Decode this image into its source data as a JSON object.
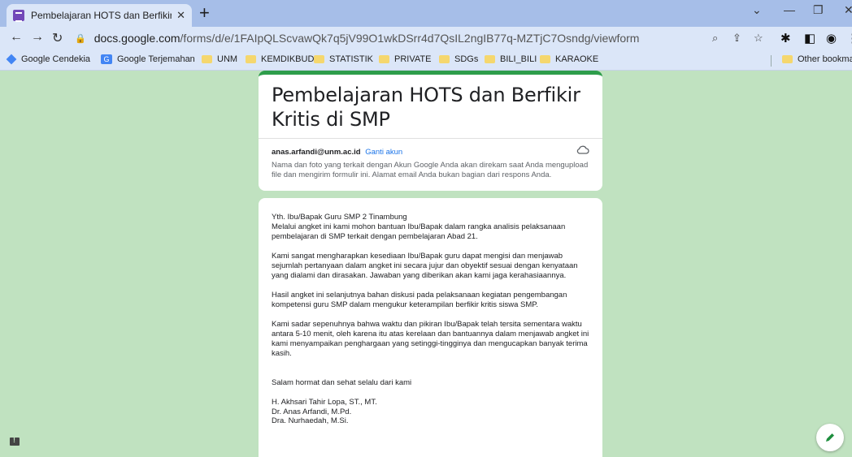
{
  "browser": {
    "tab_title": "Pembelajaran HOTS dan Berfikir",
    "tab_close": "✕",
    "new_tab": "+",
    "window_controls": [
      "⌄",
      "—",
      "❐",
      "✕"
    ],
    "url_host": "docs.google.com",
    "url_path": "/forms/d/e/1FAIpQLScvawQk7q5jV99O1wkDSrr4d7QsIL2ngIB77q-MZTjC7Osndg/viewform",
    "bookmarks": [
      {
        "label": "Google Cendekia",
        "icon": "scholar-icon"
      },
      {
        "label": "Google Terjemahan",
        "icon": "translate-icon"
      },
      {
        "label": "UNM",
        "icon": "folder-icon"
      },
      {
        "label": "KEMDIKBUD",
        "icon": "folder-icon"
      },
      {
        "label": "STATISTIK",
        "icon": "folder-icon"
      },
      {
        "label": "PRIVATE",
        "icon": "folder-icon"
      },
      {
        "label": "SDGs",
        "icon": "folder-icon"
      },
      {
        "label": "BILI_BILI",
        "icon": "folder-icon"
      },
      {
        "label": "KARAOKE",
        "icon": "folder-icon"
      }
    ],
    "other_bookmarks": "Other bookmar"
  },
  "colors": {
    "page_bg": "#c0e2c0",
    "accent": "#2e9d4b",
    "link": "#1a73e8",
    "tab_strip": "#a6bee8",
    "toolbar": "#dbe6f8"
  },
  "form": {
    "title": "Pembelajaran HOTS dan Berfikir Kritis di SMP",
    "account_email": "anas.arfandi@unm.ac.id",
    "switch_account": "Ganti akun",
    "account_note": "Nama dan foto yang terkait dengan Akun Google Anda akan direkam saat Anda mengupload file dan mengirim formulir ini. Alamat email Anda bukan bagian dari respons Anda.",
    "greeting": "Yth. Ibu/Bapak Guru SMP 2 Tinambung",
    "intro": "Melalui angket ini kami mohon bantuan Ibu/Bapak dalam rangka analisis pelaksanaan pembelajaran di SMP terkait dengan pembelajaran Abad 21.",
    "para2": "Kami sangat mengharapkan kesediaan Ibu/Bapak guru dapat mengisi dan menjawab sejumlah pertanyaan dalam angket ini secara jujur dan obyektif sesuai dengan kenyataan yang dialami dan dirasakan. Jawaban yang diberikan akan kami jaga kerahasiaannya.",
    "para3": "Hasil angket ini selanjutnya bahan diskusi pada pelaksanaan kegiatan pengembangan kompetensi guru SMP dalam mengukur keterampilan berfikir kritis siswa SMP.",
    "para4": "Kami sadar sepenuhnya bahwa waktu dan pikiran Ibu/Bapak telah tersita sementara waktu antara 5-10 menit, oleh karena itu atas kerelaan dan bantuannya dalam menjawab angket ini kami menyampaikan penghargaan yang setinggi-tingginya dan mengucapkan banyak terima kasih.",
    "closing": "Salam hormat dan sehat selalu dari kami",
    "signatories": [
      "H. Akhsari Tahir Lopa, ST., MT.",
      "Dr. Anas Arfandi, M.Pd.",
      "Dra. Nurhaedah, M.Si."
    ]
  }
}
